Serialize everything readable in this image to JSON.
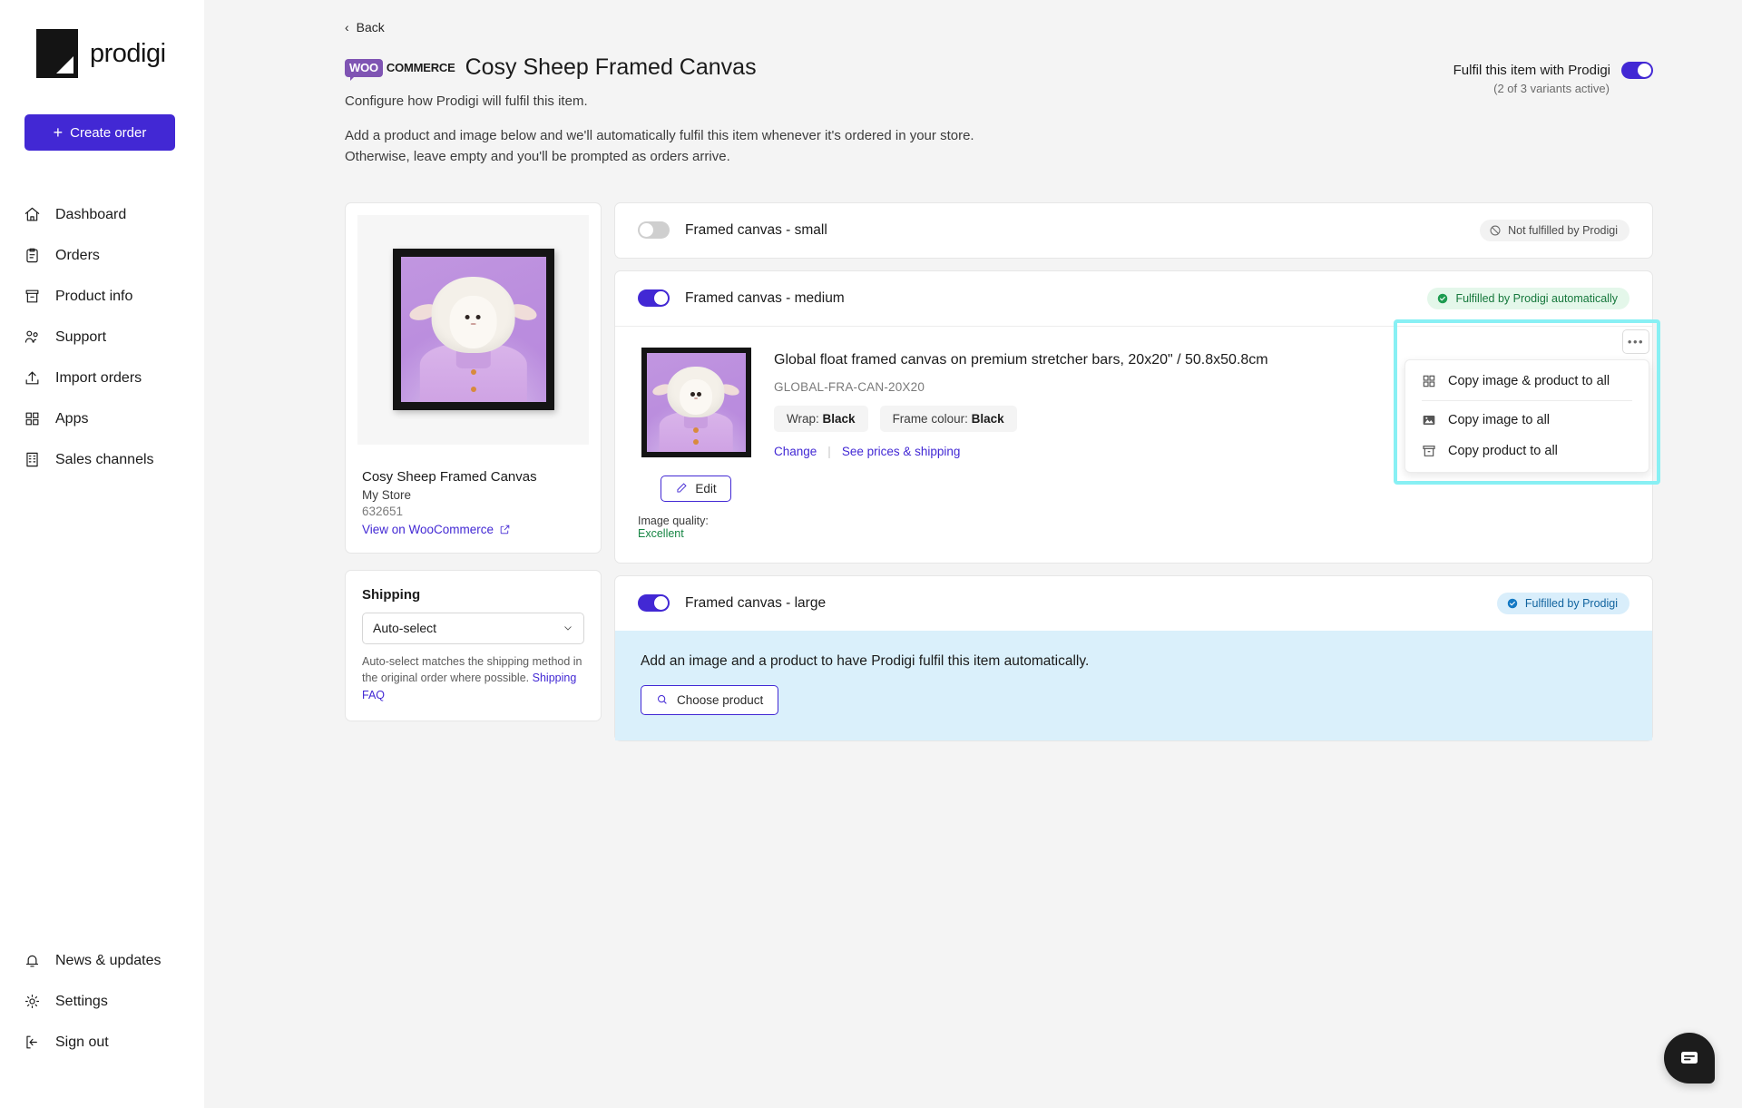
{
  "sidebar": {
    "brand": "prodigi",
    "create_order_label": "Create order",
    "items": [
      {
        "label": "Dashboard",
        "icon": "home-icon"
      },
      {
        "label": "Orders",
        "icon": "clipboard-icon"
      },
      {
        "label": "Product info",
        "icon": "archive-icon"
      },
      {
        "label": "Support",
        "icon": "people-icon"
      },
      {
        "label": "Import orders",
        "icon": "upload-icon"
      },
      {
        "label": "Apps",
        "icon": "grid-icon"
      },
      {
        "label": "Sales channels",
        "icon": "building-icon"
      }
    ],
    "bottom_items": [
      {
        "label": "News & updates",
        "icon": "bell-icon"
      },
      {
        "label": "Settings",
        "icon": "gear-icon"
      },
      {
        "label": "Sign out",
        "icon": "sign-out-icon"
      }
    ]
  },
  "header": {
    "back_label": "Back",
    "woo_pill": "WOO",
    "woo_word": "COMMERCE",
    "title": "Cosy Sheep Framed Canvas",
    "subtitle": "Configure how Prodigi will fulfil this item.",
    "paragraph_line1": "Add a product and image below and we'll automatically fulfil this item whenever it's ordered in your store.",
    "paragraph_line2": "Otherwise, leave empty and you'll be prompted as orders arrive.",
    "fulfil_toggle_label": "Fulfil this item with Prodigi",
    "fulfil_variants_note": "(2 of 3 variants active)",
    "fulfil_toggle_state": "on"
  },
  "product_card": {
    "name": "Cosy Sheep Framed Canvas",
    "store": "My Store",
    "id": "632651",
    "view_link": "View on WooCommerce"
  },
  "shipping": {
    "title": "Shipping",
    "selected": "Auto-select",
    "help_text": "Auto-select matches the shipping method in the original order where possible.",
    "faq_link": "Shipping FAQ"
  },
  "variants": [
    {
      "title": "Framed canvas - small",
      "toggle": "off",
      "badge": {
        "text": "Not fulfilled by Prodigi",
        "style": "grey",
        "icon": "no-entry-icon"
      }
    },
    {
      "title": "Framed canvas - medium",
      "toggle": "on",
      "badge": {
        "text": "Fulfilled by Prodigi automatically",
        "style": "green",
        "icon": "check-circle-icon"
      }
    },
    {
      "title": "Framed canvas - large",
      "toggle": "on",
      "badge": {
        "text": "Fulfilled by Prodigi",
        "style": "blue",
        "icon": "check-circle-icon"
      }
    }
  ],
  "medium_detail": {
    "product_title": "Global float framed canvas on premium stretcher bars, 20x20\" / 50.8x50.8cm",
    "sku": "GLOBAL-FRA-CAN-20X20",
    "attributes": [
      {
        "label": "Wrap:",
        "value": "Black"
      },
      {
        "label": "Frame colour:",
        "value": "Black"
      }
    ],
    "change_link": "Change",
    "prices_link": "See prices & shipping",
    "edit_label": "Edit",
    "image_quality_label": "Image quality:",
    "image_quality_value": "Excellent",
    "more_button": "•••"
  },
  "menu": {
    "highlighted": true,
    "highlight_color": "#88f0f4",
    "items": [
      {
        "label": "Copy image & product to all",
        "icon": "grid-icon"
      },
      {
        "label": "Copy image to all",
        "icon": "image-icon"
      },
      {
        "label": "Copy product to all",
        "icon": "archive-icon"
      }
    ]
  },
  "large_panel": {
    "text": "Add an image and a product to have Prodigi fulfil this item automatically.",
    "choose_product_label": "Choose product"
  },
  "chat": {
    "icon": "chat-bubble-icon"
  },
  "colors": {
    "brand_purple": "#4228d4",
    "woo_purple": "#7f54b3",
    "highlight_cyan": "#88f0f4",
    "badge_green_bg": "#e4f7ea",
    "badge_green_text": "#16783c",
    "badge_blue_bg": "#d9eefb",
    "badge_blue_text": "#10639e",
    "panel_blue_bg": "#daf0fb",
    "page_bg": "#f4f4f4"
  }
}
